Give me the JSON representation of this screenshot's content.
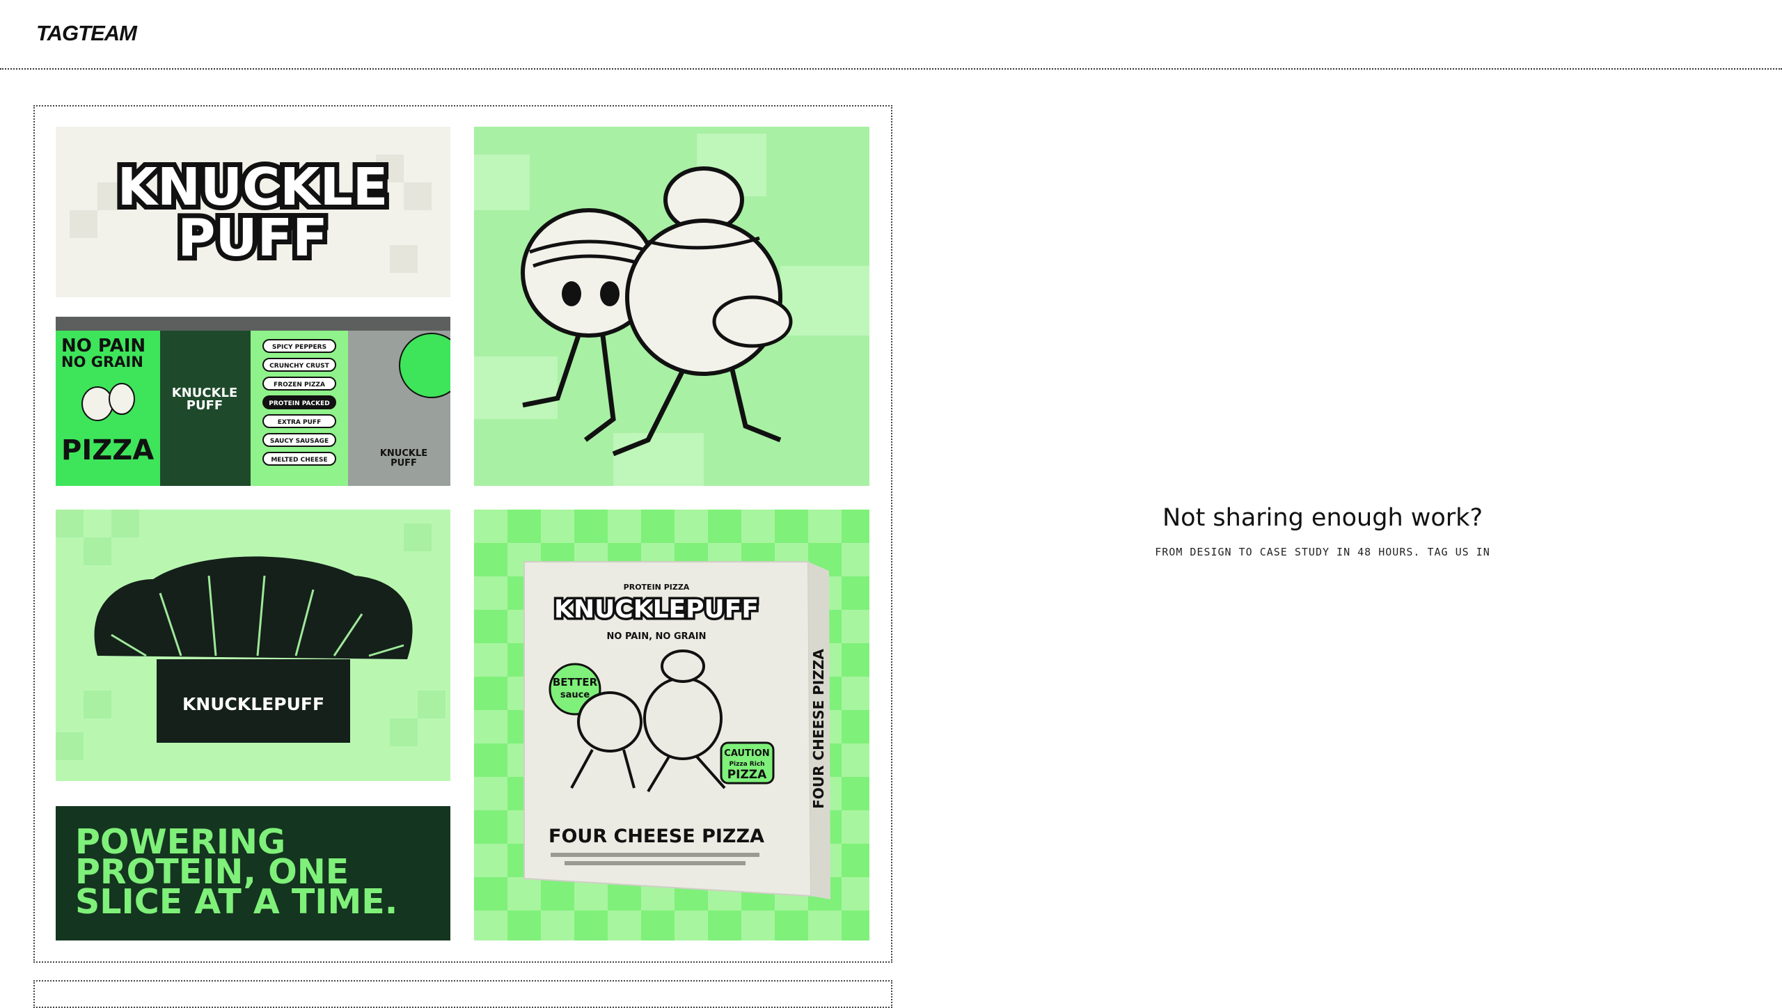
{
  "header": {
    "logo": "TAGTEAM"
  },
  "project": {
    "tiles": {
      "logo_line1": "KNUCKLE",
      "logo_line2": "PUFF",
      "billboard": {
        "slogan1": "NO PAIN",
        "slogan2": "NO GRAIN",
        "pizza": "PIZZA",
        "brand1": "KNUCKLE",
        "brand2": "PUFF",
        "tags": [
          "SPICY PEPPERS",
          "CRUNCHY CRUST",
          "FROZEN PIZZA",
          "PROTEIN PACKED",
          "EXTRA PUFF",
          "SAUCY SAUSAGE",
          "MELTED CHEESE"
        ]
      },
      "chef_hat_label": "KNUCKLEPUFF",
      "tagline1": "POWERING",
      "tagline2": "PROTEIN, ONE",
      "tagline3": "SLICE AT A TIME.",
      "box": {
        "kicker": "PROTEIN PIZZA",
        "brand": "KNUCKLEPUFF",
        "sub": "NO PAIN, NO GRAIN",
        "badge1": "BETTER",
        "badge2": "sauce",
        "caution1": "CAUTION",
        "caution2": "Pizza Rich",
        "caution3": "PIZZA",
        "product": "FOUR CHEESE PIZZA",
        "side": "FOUR CHEESE PIZZA"
      }
    }
  },
  "promo": {
    "headline": "Not sharing enough work?",
    "subline": "FROM DESIGN TO CASE STUDY IN 48 HOURS. TAG US IN"
  },
  "colors": {
    "mint": "#a8f0a4",
    "green": "#7ff07a",
    "dark_green": "#14351f",
    "cream": "#f2f1ea",
    "ink": "#111111"
  }
}
